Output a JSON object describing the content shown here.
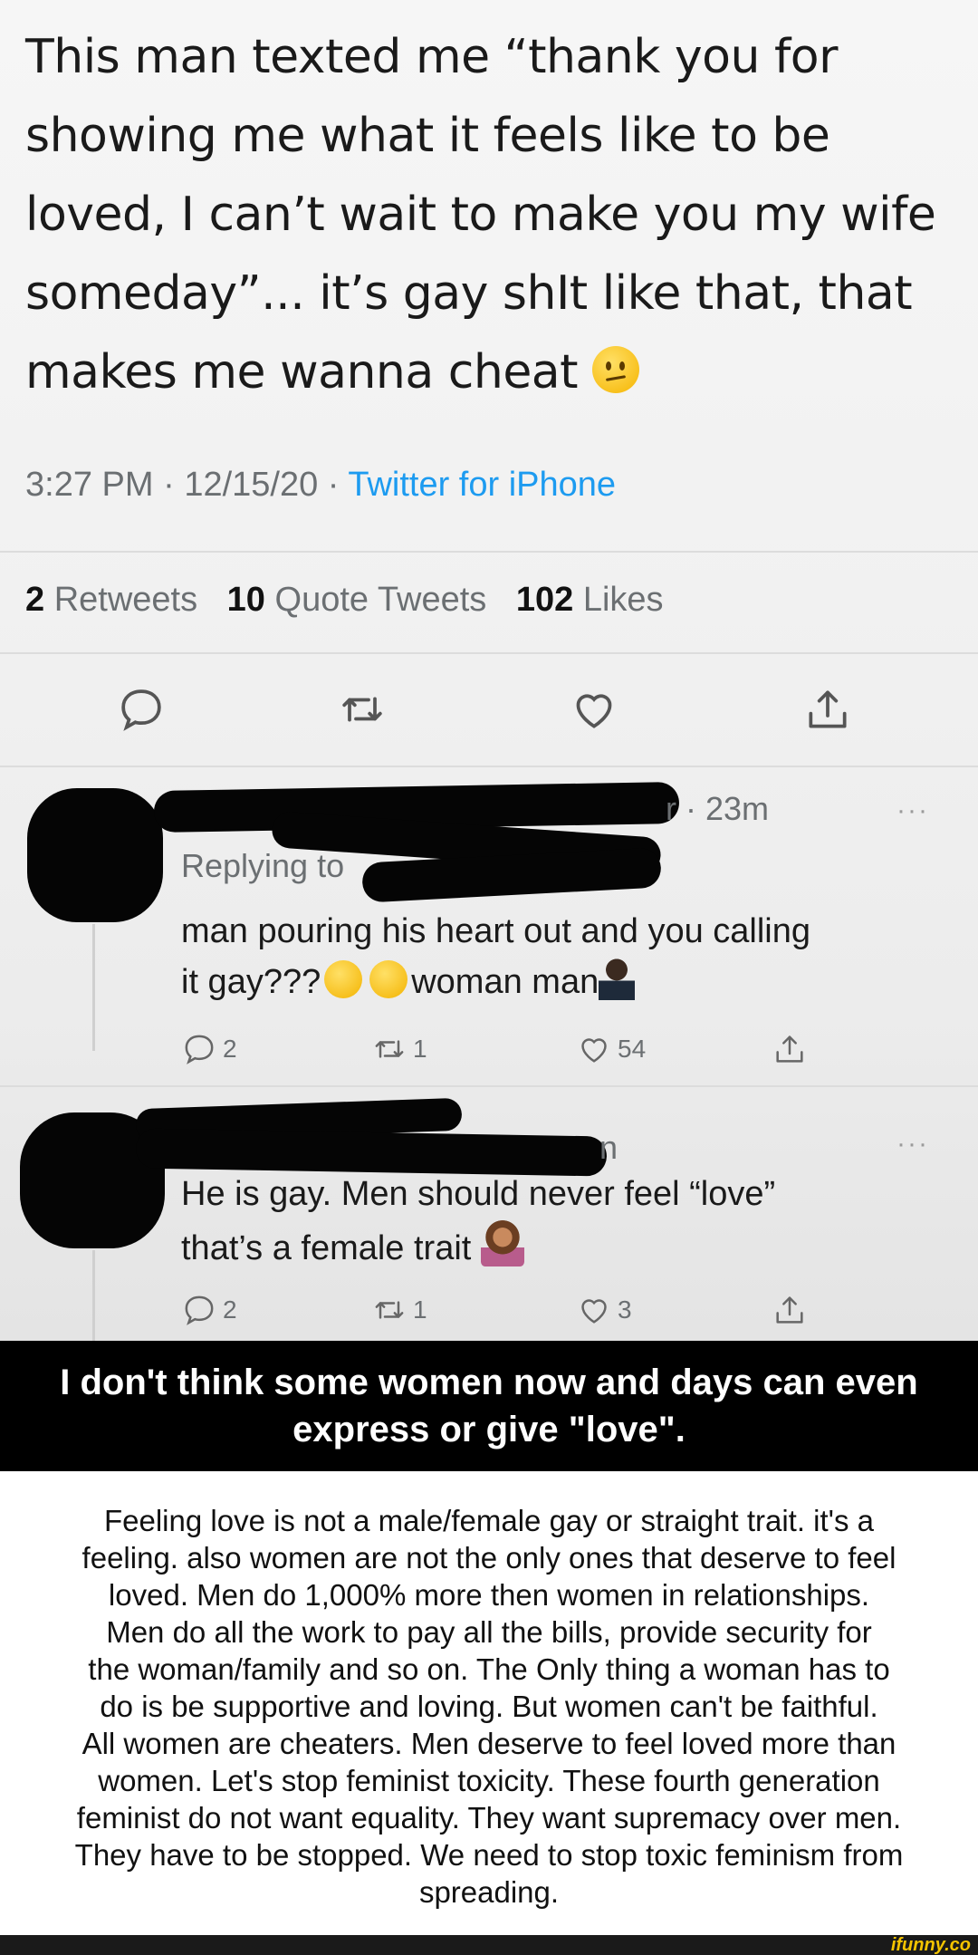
{
  "tweet": {
    "text_lines": [
      "This man texted me “thank you for",
      "showing me what it feels like to be",
      "loved, I can’t wait to make you my wife",
      "someday”... it’s gay shIt like that, that",
      "makes me wanna cheat"
    ],
    "emoji": "confused-face",
    "time": "3:27 PM",
    "date": "12/15/20",
    "source": "Twitter for iPhone",
    "sep": "·",
    "retweets_count": "2",
    "retweets_label": "Retweets",
    "quotes_count": "10",
    "quotes_label": "Quote Tweets",
    "likes_count": "102",
    "likes_label": "Likes"
  },
  "replies": [
    {
      "handle_tail": "r · 23m",
      "replying_to": "Replying to",
      "text_line1": "man pouring his heart out and you calling",
      "text_line2_a": "it gay???",
      "text_line2_b": "woman man",
      "reply_count": "2",
      "retweet_count": "1",
      "like_count": "54",
      "more": "···"
    },
    {
      "handle_tail": "n",
      "text_line1": "He is gay. Men should never feel “love”",
      "text_line2": "that’s a female trait",
      "reply_count": "2",
      "retweet_count": "1",
      "like_count": "3",
      "more": "···"
    }
  ],
  "caption": {
    "line1": "I don't think some women now and days can even",
    "line2": "express or give \"love\"."
  },
  "body": {
    "lines": [
      "Feeling love is not a male/female gay or straight trait. it's a",
      "feeling. also women are not the only ones that deserve to feel",
      "loved. Men do 1,000% more then women in relationships.",
      "Men do all the work to pay all the bills, provide security for",
      "the woman/family and so on. The Only thing a woman has to",
      "do is be supportive and loving. But women can't be faithful.",
      "All women are cheaters. Men deserve to feel loved more than",
      "women. Let's stop feminist toxicity. These fourth generation",
      "feminist do not want equality. They want supremacy over men.",
      "They have to be stopped. We need to stop toxic feminism from",
      "spreading."
    ]
  },
  "footer": {
    "watermark": "ifunny.co"
  },
  "colors": {
    "link": "#1d9bf0",
    "meta": "#6b6f72",
    "caption_bg": "#000000",
    "watermark": "#f4c400"
  }
}
